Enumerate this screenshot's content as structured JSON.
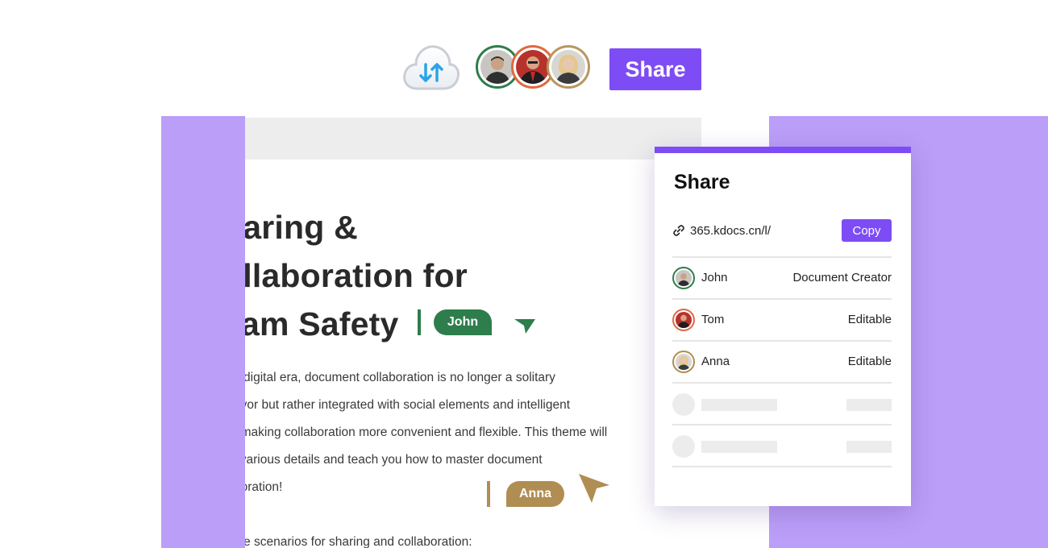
{
  "toolbar": {
    "sync_icon": "cloud-sync-icon",
    "share_label": "Share",
    "collaborators": [
      "John",
      "Tom",
      "Anna"
    ]
  },
  "document": {
    "title_lines": [
      "haring &",
      "ollaboration for",
      "eam Safety"
    ],
    "body_lines": [
      "s digital era, document collaboration is no longer a solitary",
      "avor but rather integrated with social elements and intelligent",
      ", making collaboration more convenient and flexible. This theme will",
      "l various details and teach you how to master document",
      "boration!"
    ],
    "body_line_last": "ple scenarios for sharing and collaboration:",
    "cursor_john": "John",
    "cursor_anna": "Anna"
  },
  "share_panel": {
    "title": "Share",
    "link": "365.kdocs.cn/l/",
    "copy_label": "Copy",
    "users": [
      {
        "name": "John",
        "role": "Document Creator"
      },
      {
        "name": "Tom",
        "role": "Editable"
      },
      {
        "name": "Anna",
        "role": "Editable"
      }
    ]
  },
  "colors": {
    "accent": "#7e4cf5",
    "backdrop": "#bb9ef8",
    "john": "#2e7d4c",
    "tom": "#e0693e",
    "anna": "#b08d52"
  }
}
